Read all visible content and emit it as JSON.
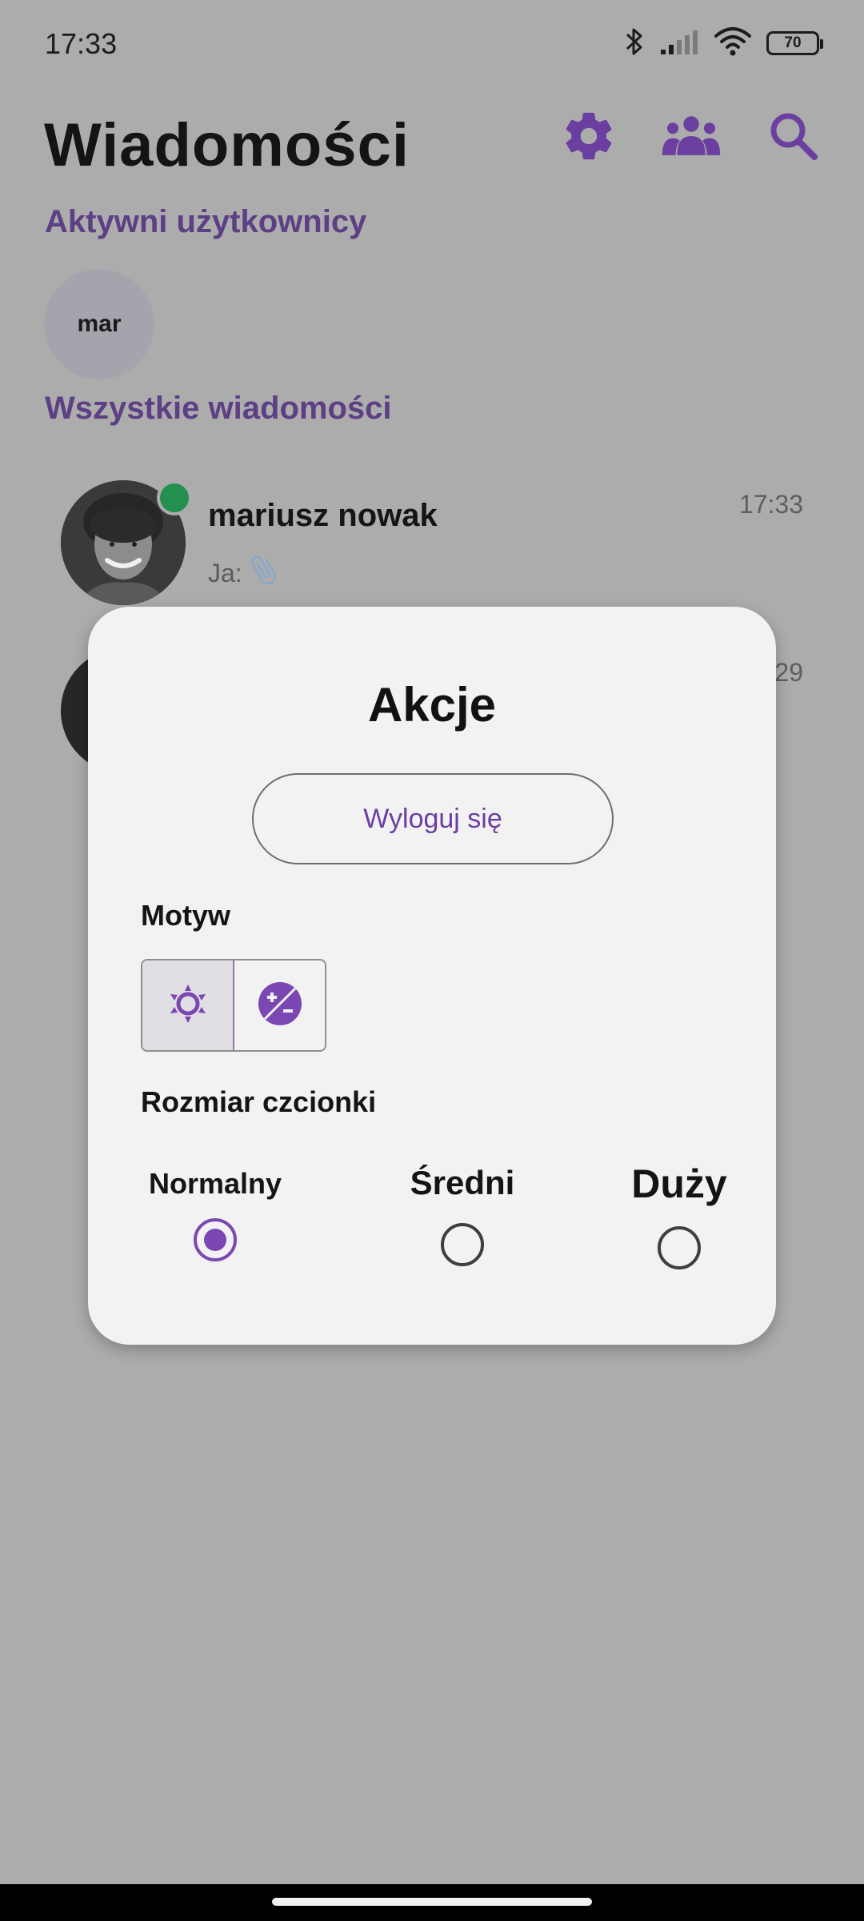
{
  "status_bar": {
    "time": "17:33",
    "battery_level": "70",
    "icons": [
      "bluetooth-icon",
      "cellular-signal-icon",
      "wifi-icon",
      "battery-icon"
    ]
  },
  "header": {
    "title": "Wiadomości",
    "actions": [
      "settings-icon",
      "people-icon",
      "search-icon"
    ]
  },
  "active_users": {
    "section_title": "Aktywni użytkownicy",
    "items": [
      {
        "label": "mar"
      }
    ]
  },
  "all_messages": {
    "section_title": "Wszystkie wiadomości",
    "conversations": [
      {
        "name": "mariusz nowak",
        "preview": "Ja:",
        "attachment_icon": "paperclip-icon",
        "time": "17:33",
        "online": true
      },
      {
        "name": "",
        "preview": "",
        "time": "29",
        "online": false
      }
    ]
  },
  "modal": {
    "title": "Akcje",
    "logout_label": "Wyloguj się",
    "theme_label": "Motyw",
    "theme_options": [
      {
        "icon": "light-theme-icon",
        "selected": true
      },
      {
        "icon": "contrast-theme-icon",
        "selected": false
      }
    ],
    "font_size_label": "Rozmiar czcionki",
    "font_options": [
      {
        "label": "Normalny",
        "checked": true
      },
      {
        "label": "Średni",
        "checked": false
      },
      {
        "label": "Duży",
        "checked": false
      }
    ]
  },
  "colors": {
    "accent": "#6b3fa0",
    "section_title": "#5c3f84",
    "online_dot": "#24904f",
    "scrim_background": "#acacac",
    "modal_background": "#f3f2f3"
  }
}
